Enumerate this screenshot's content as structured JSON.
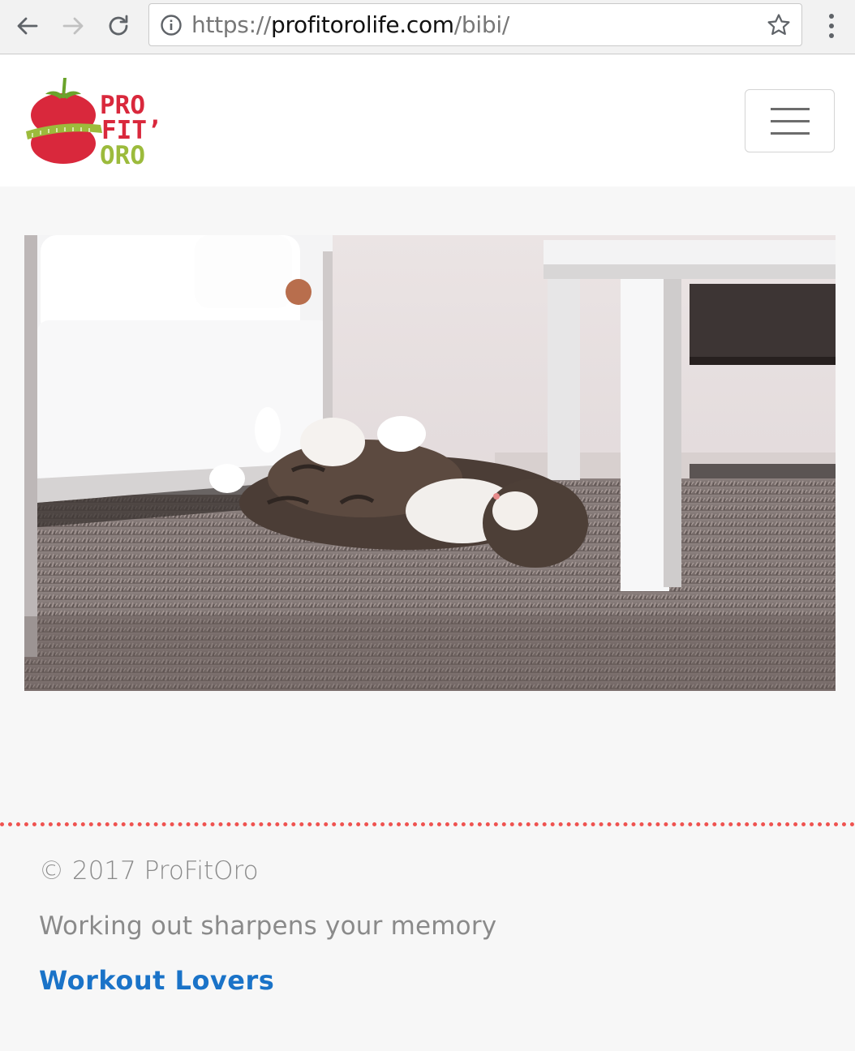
{
  "browser": {
    "url_scheme": "https://",
    "url_host": "profitorolife.com",
    "url_path": "/bibi/"
  },
  "header": {
    "logo_text": [
      "PRO",
      "FIT’",
      "ORO"
    ]
  },
  "footer": {
    "copyright": "© 2017 ProFitOro",
    "tagline": "Working out sharpens your memory",
    "link_label": "Workout Lovers"
  },
  "colors": {
    "divider": "#ef5350",
    "link": "#1a73c8",
    "logo_red": "#d9283c",
    "logo_green": "#9cbb3c"
  }
}
